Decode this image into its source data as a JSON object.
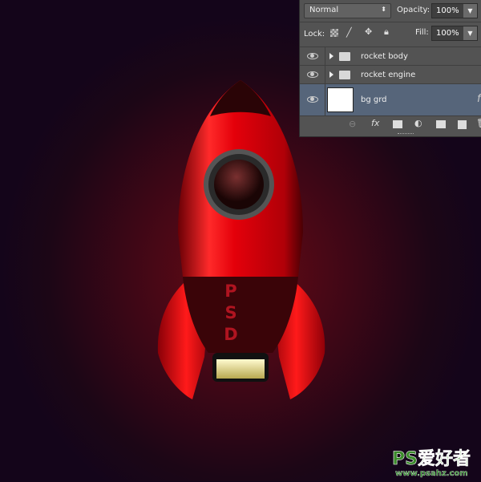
{
  "canvas": {
    "rocket_text": "PSD",
    "body_color": "#e8000a",
    "background_center": "#6a0b14",
    "background_edge": "#14051a"
  },
  "layers_panel": {
    "blend_mode": "Normal",
    "opacity_label": "Opacity:",
    "opacity_value": "100%",
    "lock_label": "Lock:",
    "fill_label": "Fill:",
    "fill_value": "100%",
    "layers": [
      {
        "name": "rocket body",
        "type": "group",
        "visible": true,
        "selected": false
      },
      {
        "name": "rocket engine",
        "type": "group",
        "visible": true,
        "selected": false
      },
      {
        "name": "bg grd",
        "type": "layer",
        "visible": true,
        "selected": true,
        "fx": "f"
      }
    ],
    "toolbar_icons": [
      "link-icon",
      "fx-icon",
      "mask-icon",
      "adjustment-icon",
      "folder-icon",
      "new-layer-icon",
      "trash-icon"
    ],
    "selected_color": "#56657a"
  },
  "watermark": {
    "logo": "PS爱好者",
    "url": "www.psahz.com"
  }
}
